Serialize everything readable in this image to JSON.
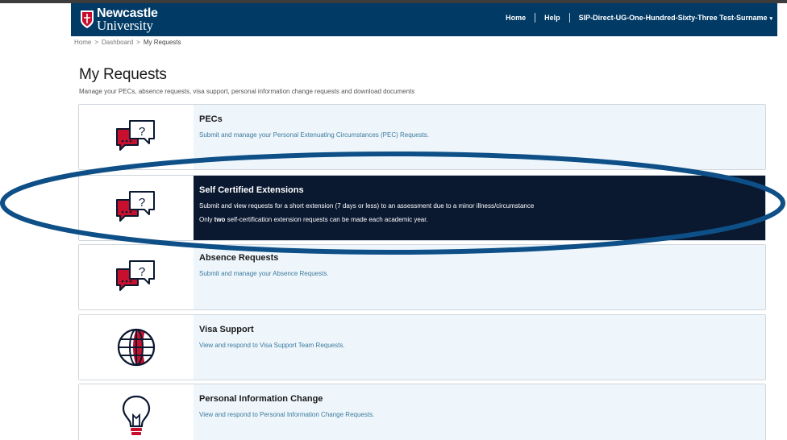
{
  "navbar": {
    "logo_line1": "Newcastle",
    "logo_line2": "University",
    "home": "Home",
    "help": "Help",
    "user": "SIP-Direct-UG-One-Hundred-Sixty-Three Test-Surname",
    "user_caret": "▾"
  },
  "breadcrumb": {
    "home": "Home",
    "sep1": ">",
    "dashboard": "Dashboard",
    "sep2": ">",
    "current": "My Requests"
  },
  "page": {
    "title": "My Requests",
    "subtitle": "Manage your PECs, absence requests, visa support, personal information change requests and download documents"
  },
  "cards": [
    {
      "title": "PECs",
      "desc": "Submit and manage your Personal Extenuating Circumstances (PEC) Requests.",
      "icon": "speech-bubbles-question-icon"
    },
    {
      "title": "Self Certified Extensions",
      "desc": "Submit and view requests for a short extension (7 days or less) to an assessment due to a minor illness/circumstance",
      "note_pre": "Only ",
      "note_bold": "two",
      "note_post": " self-certification extension requests can be made each academic year.",
      "icon": "speech-bubbles-question-icon"
    },
    {
      "title": "Absence Requests",
      "desc": "Submit and manage your Absence Requests.",
      "icon": "speech-bubbles-question-icon"
    },
    {
      "title": "Visa Support",
      "desc": "View and respond to Visa Support Team Requests.",
      "icon": "globe-icon"
    },
    {
      "title": "Personal Information Change",
      "desc": "View and respond to Personal Information Change Requests.",
      "icon": "lightbulb-icon"
    }
  ],
  "colors": {
    "navbar": "#003a65",
    "accent_red": "#c8102e",
    "active_card": "#0a1830",
    "card_bg": "#eef6fc",
    "highlight_ellipse": "#0d4f86"
  }
}
